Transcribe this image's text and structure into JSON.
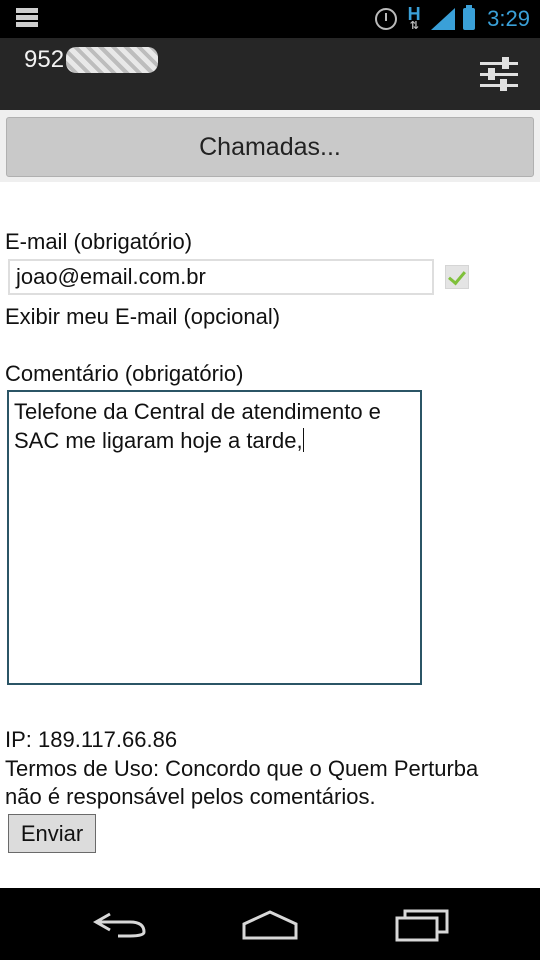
{
  "status_bar": {
    "time": "3:29",
    "network": "H",
    "icons": [
      "menu-grid-icon",
      "alarm-icon",
      "network-h-icon",
      "signal-icon",
      "battery-icon"
    ]
  },
  "action_bar": {
    "title_prefix": "952",
    "title_redacted": true,
    "settings_icon": "sliders-icon"
  },
  "calls_button": {
    "label": "Chamadas..."
  },
  "form": {
    "email_label": "E-mail (obrigatório)",
    "email_value": "joao@email.com.br",
    "show_email_label": "Exibir meu E-mail (opcional)",
    "show_email_checked": true,
    "comment_label": "Comentário (obrigatório)",
    "comment_value": "Telefone da Central de atendimento e SAC me ligaram hoje a tarde,",
    "ip_text": "IP: 189.117.66.86",
    "terms_line1": "Termos de Uso: Concordo que o Quem Perturba",
    "terms_line2": "não é responsável pelos comentários.",
    "submit_label": "Enviar"
  },
  "nav_bar": {
    "icons": [
      "back-icon",
      "home-icon",
      "recents-icon"
    ]
  },
  "colors": {
    "accent": "#3aa0d8",
    "check": "#7fc03a",
    "action_bar": "#262626"
  }
}
